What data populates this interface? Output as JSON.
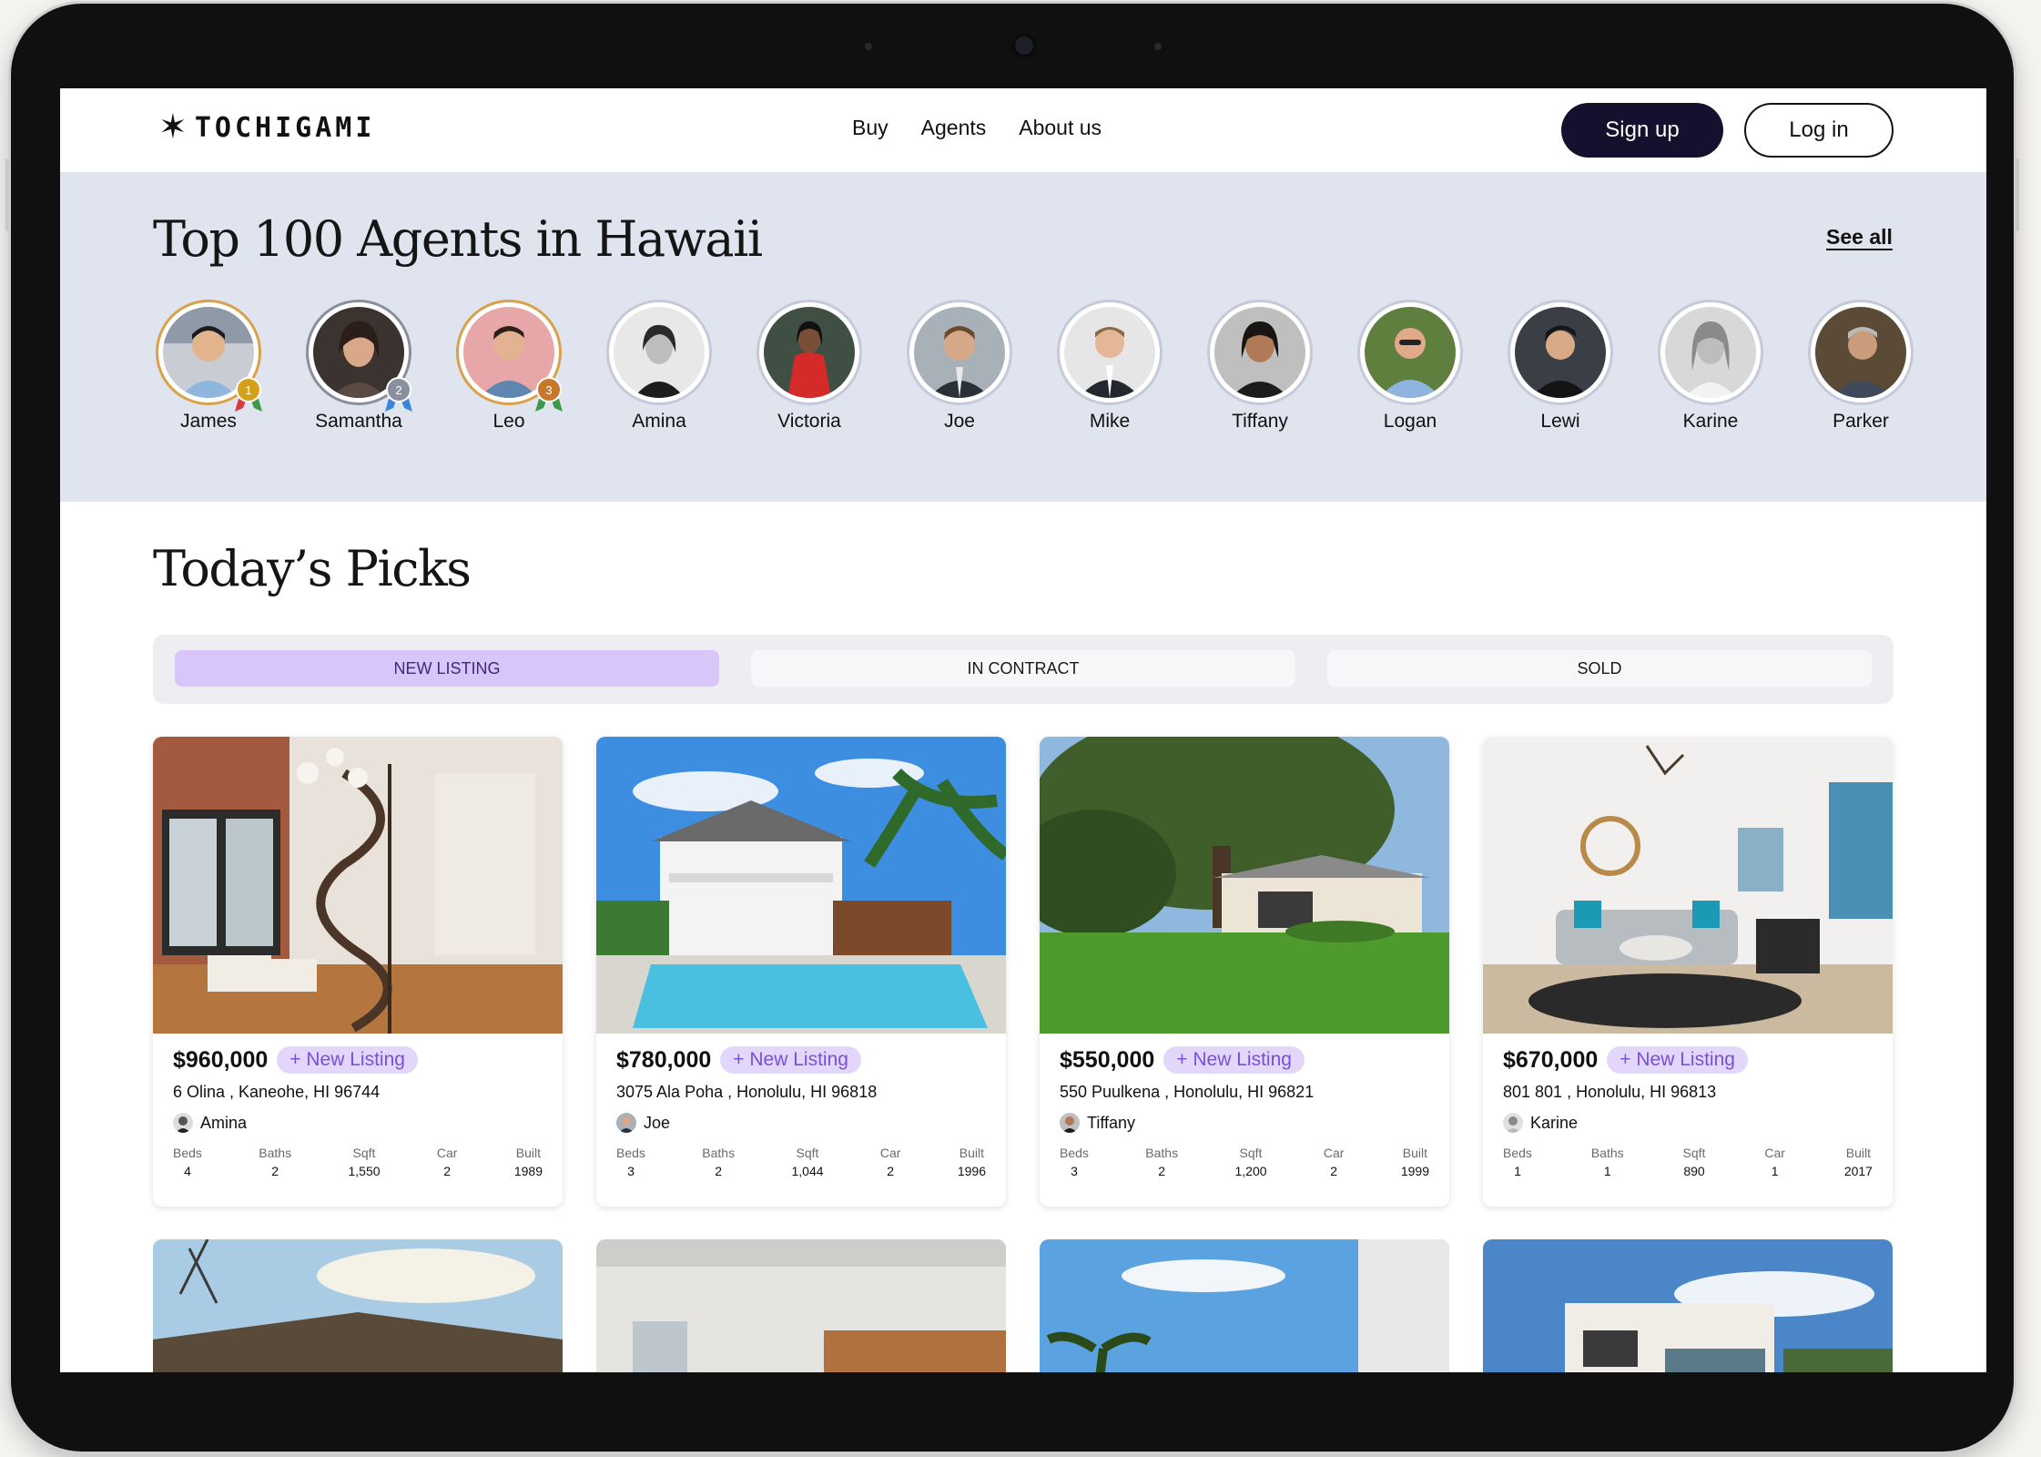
{
  "brand": {
    "logo_text": "TOCHIGAMI",
    "logo_icon": "star-burst-icon"
  },
  "nav": {
    "links": [
      "Buy",
      "Agents",
      "About us"
    ],
    "signup_label": "Sign up",
    "login_label": "Log in"
  },
  "agents_section": {
    "title": "Top 100 Agents in Hawaii",
    "see_all_label": "See all",
    "agents": [
      {
        "name": "James",
        "rank": "1"
      },
      {
        "name": "Samantha",
        "rank": "2"
      },
      {
        "name": "Leo",
        "rank": "3"
      },
      {
        "name": "Amina"
      },
      {
        "name": "Victoria"
      },
      {
        "name": "Joe"
      },
      {
        "name": "Mike"
      },
      {
        "name": "Tiffany"
      },
      {
        "name": "Logan"
      },
      {
        "name": "Lewi"
      },
      {
        "name": "Karine"
      },
      {
        "name": "Parker"
      }
    ]
  },
  "picks_section": {
    "title": "Today’s Picks",
    "tabs": [
      "NEW LISTING",
      "IN CONTRACT",
      "SOLD"
    ],
    "active_tab": "NEW LISTING",
    "stat_labels": [
      "Beds",
      "Baths",
      "Sqft",
      "Car",
      "Built"
    ],
    "listings": [
      {
        "price": "$960,000",
        "badge": "+ New Listing",
        "address": "6 Olina , Kaneohe, HI 96744",
        "agent": "Amina",
        "beds": "4",
        "baths": "2",
        "sqft": "1,550",
        "car": "2",
        "built": "1989"
      },
      {
        "price": "$780,000",
        "badge": "+ New Listing",
        "address": "3075 Ala Poha , Honolulu, HI 96818",
        "agent": "Joe",
        "beds": "3",
        "baths": "2",
        "sqft": "1,044",
        "car": "2",
        "built": "1996"
      },
      {
        "price": "$550,000",
        "badge": "+ New Listing",
        "address": "550 Puulkena , Honolulu, HI 96821",
        "agent": "Tiffany",
        "beds": "3",
        "baths": "2",
        "sqft": "1,200",
        "car": "2",
        "built": "1999"
      },
      {
        "price": "$670,000",
        "badge": "+ New Listing",
        "address": "801 801 , Honolulu, HI 96813",
        "agent": "Karine",
        "beds": "1",
        "baths": "1",
        "sqft": "890",
        "car": "1",
        "built": "2017"
      }
    ]
  },
  "colors": {
    "accent_dark": "#14102e",
    "band_bg": "#e0e4ef",
    "tab_active_bg": "#d8c6fa",
    "badge_bg": "#e3d6fb",
    "badge_text": "#7b4fd8",
    "medal_gold": "#d4a017",
    "medal_silver": "#8a8f9e",
    "medal_bronze": "#c8782a"
  }
}
